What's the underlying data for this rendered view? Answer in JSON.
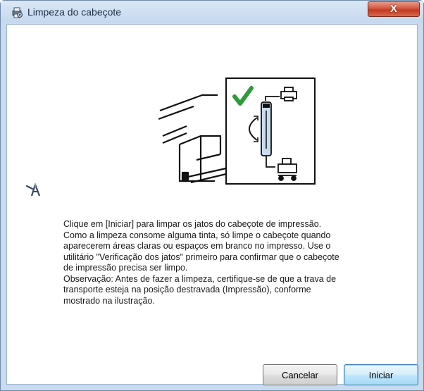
{
  "window": {
    "title": "Limpeza do cabeçote",
    "title_icon": "printer-gear-icon",
    "close_label": "X"
  },
  "illustration": {
    "description_icons": [
      "printer-body-icon",
      "green-checkmark-icon",
      "printer-small-icon",
      "transport-lock-lever-icon",
      "cart-icon"
    ],
    "accent_colors": {
      "check": "#2e9b3a",
      "lever": "#c8ddf0"
    }
  },
  "tool_icon": "utility-wrench-icon",
  "message": {
    "text": "Clique em [Iniciar] para limpar os jatos do cabeçote de impressão.\nComo a limpeza consome alguma tinta, só limpe o cabeçote quando\naparecerem áreas claras ou espaços em branco no impresso. Use o\nutilitário \"Verificação dos jatos\" primeiro para confirmar que o cabeçote\nde impressão precisa ser limpo.\nObservação: Antes de fazer a limpeza, certifique-se de que a trava de\ntransporte esteja na posição destravada (Impressão), conforme\nmostrado na ilustração."
  },
  "buttons": {
    "cancel_label": "Cancelar",
    "start_label": "Iniciar"
  }
}
